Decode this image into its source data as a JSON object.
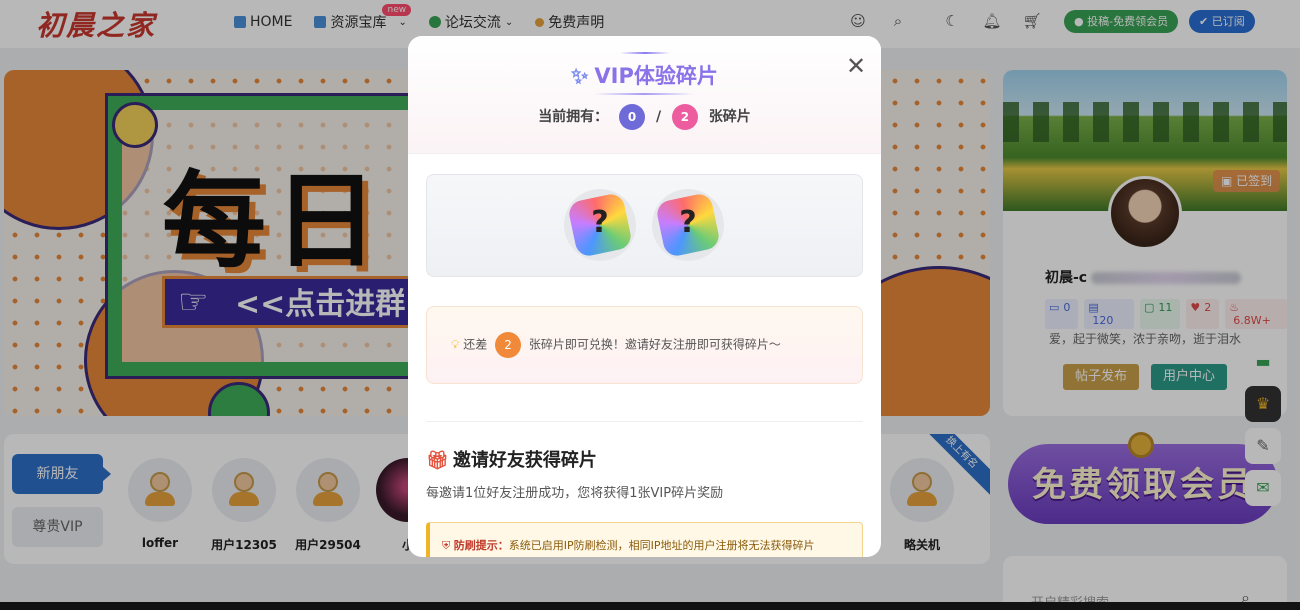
{
  "header": {
    "logo": "初晨之家",
    "nav": [
      {
        "label": "HOME",
        "icon": "home-icon",
        "color": "#4a90d9"
      },
      {
        "label": "资源宝库",
        "icon": "folder-icon",
        "color": "#4a90d9",
        "badge": "new",
        "dropdown": true
      },
      {
        "label": "论坛交流",
        "icon": "forum-icon",
        "color": "#3aa356",
        "dropdown": true
      },
      {
        "label": "免费声明",
        "icon": "note-icon",
        "color": "#e6a23c"
      }
    ],
    "submit_label": "投稿-免费领会员",
    "subscribe_label": "已订阅"
  },
  "banner": {
    "title": "每日",
    "cta": "<<点击进群"
  },
  "members": {
    "tab_active": "新朋友",
    "tab_inactive": "尊贵VIP",
    "ribbon": "换上有名",
    "list": [
      {
        "name": "loffer"
      },
      {
        "name": "用户12305"
      },
      {
        "name": "用户29504"
      },
      {
        "name": "小"
      },
      {
        "name": "略关机"
      }
    ]
  },
  "profile": {
    "signed": "已签到",
    "name": "初晨-c",
    "stats": [
      "0",
      "120",
      "11",
      "2",
      "6.8W+"
    ],
    "bio": "爱，起于微笑，浓于亲吻，逝于泪水",
    "post_button": "帖子发布",
    "center_button": "用户中心"
  },
  "vip_banner": "免费领取会员",
  "search": {
    "placeholder": "开启精彩搜索"
  },
  "modal": {
    "title": "VIP体验碎片",
    "count_prefix": "当前拥有：",
    "current": "0",
    "separator": "/",
    "total": "2",
    "count_suffix": "张碎片",
    "pieces": [
      "?",
      "?"
    ],
    "hint_prefix": "还差",
    "hint_need": "2",
    "hint_suffix": "张碎片即可兑换！邀请好友注册即可获得碎片～",
    "invite_title": "邀请好友获得碎片",
    "invite_desc": "每邀请1位好友注册成功，您将获得1张VIP碎片奖励",
    "warn_label": "防刷提示：",
    "warn_text": "系统已启用IP防刷检测，相同IP地址的用户注册将无法获得碎片"
  }
}
